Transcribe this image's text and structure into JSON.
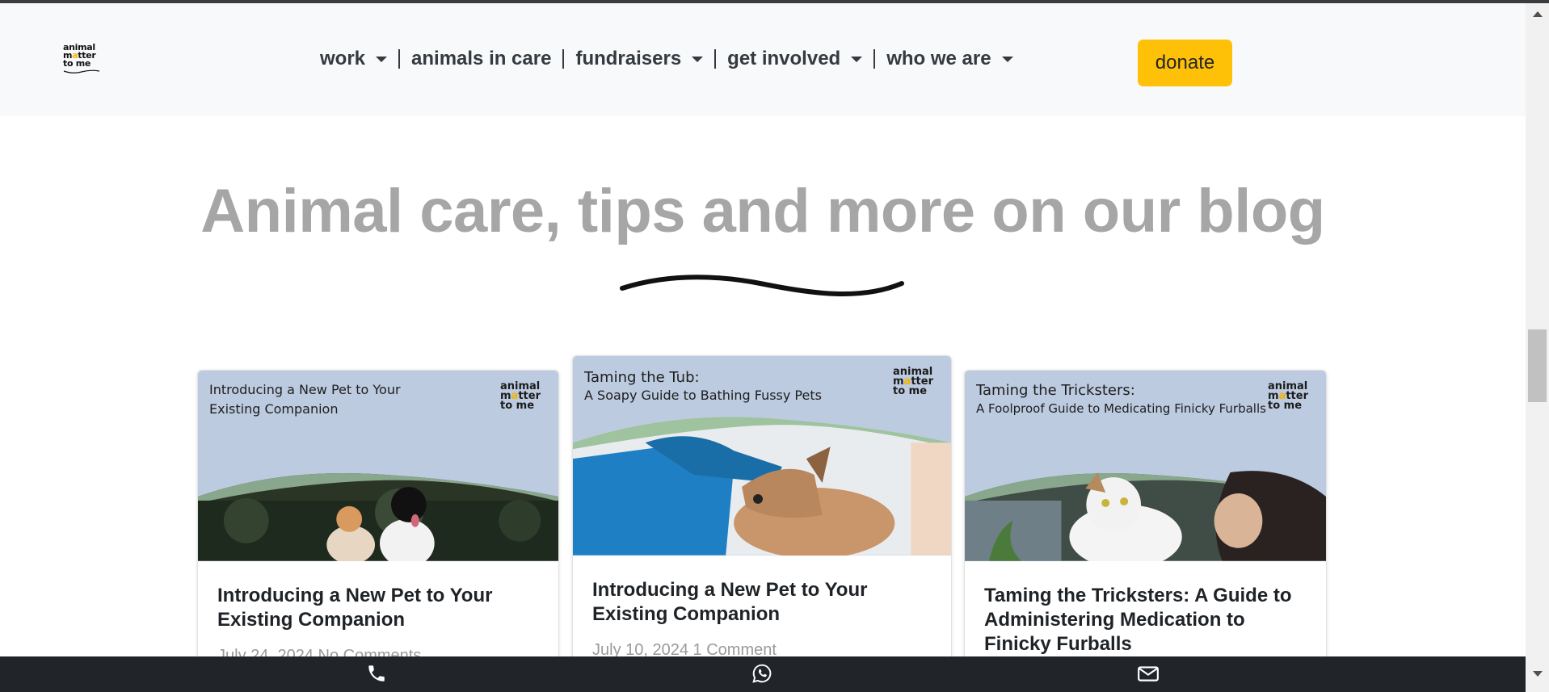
{
  "header": {
    "logo": {
      "line1": "animal",
      "line2a": "m",
      "line2dot": "a",
      "line2b": "tter",
      "line3": "to me"
    },
    "nav": [
      {
        "label": "work",
        "dropdown": true
      },
      {
        "label": "animals in care",
        "dropdown": false
      },
      {
        "label": "fundraisers",
        "dropdown": true
      },
      {
        "label": "get involved",
        "dropdown": true
      },
      {
        "label": "who we are",
        "dropdown": true
      }
    ],
    "donate_label": "donate"
  },
  "section": {
    "title": "Animal care, tips and more on our blog"
  },
  "cards": [
    {
      "banner_line1": "Introducing a New Pet to Your",
      "banner_line2": "Existing Companion",
      "title": "Introducing a New Pet to Your Existing Companion",
      "date": "July 24, 2024",
      "comments": "No Comments"
    },
    {
      "banner_line1": "Taming the Tub:",
      "banner_line2": "A Soapy Guide to Bathing Fussy Pets",
      "title": "Introducing a New Pet to Your Existing Companion",
      "date": "July 10, 2024",
      "comments": "1 Comment"
    },
    {
      "banner_line1": "Taming the Tricksters:",
      "banner_line2": "A Foolproof Guide to Medicating Finicky Furballs",
      "title": "Taming the Tricksters: A Guide to Administering Medication to Finicky Furballs",
      "date": "",
      "comments": ""
    }
  ],
  "bottom_bar": {
    "icons": [
      "phone-icon",
      "whatsapp-icon",
      "email-icon"
    ]
  },
  "colors": {
    "accent": "#ffc107",
    "banner_bg": "#bccbe0",
    "heading_gray": "#a6a6a6",
    "bottom_bar": "#212529"
  }
}
